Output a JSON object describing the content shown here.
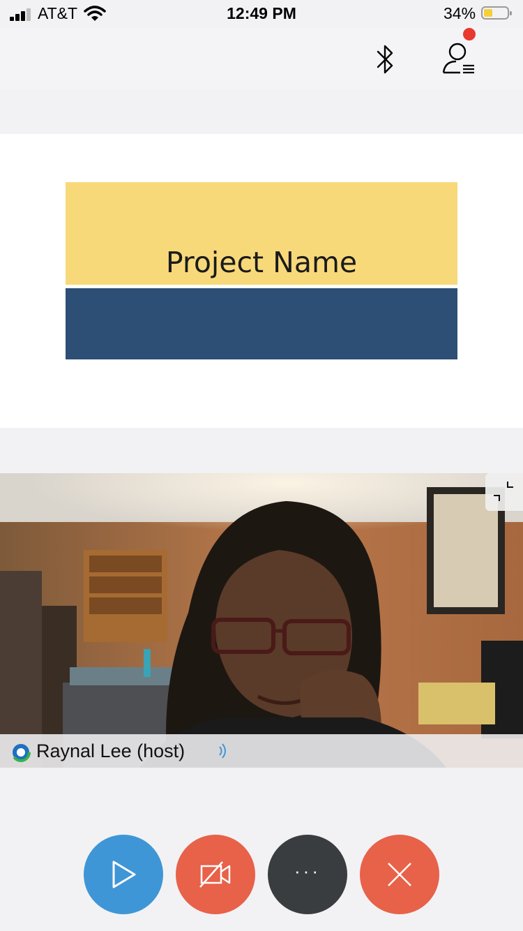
{
  "status_bar": {
    "carrier": "AT&T",
    "time": "12:49 PM",
    "battery_percent": "34%",
    "battery_level": 0.34
  },
  "toolbar": {
    "bluetooth_icon": "bluetooth-icon",
    "participants_icon": "participants-list-icon",
    "has_notification": true
  },
  "shared_content": {
    "slide_title": "Project Name",
    "colors": {
      "top_band": "#f8d97a",
      "bottom_band": "#2d4f75"
    }
  },
  "video": {
    "participant_name": "Raynal Lee (host)",
    "icons": [
      "exit-fullscreen-icon",
      "webex-logo-icon",
      "audio-speaking-icon"
    ]
  },
  "controls": [
    {
      "name": "share-button",
      "icon": "play-icon",
      "color": "#3f96d6"
    },
    {
      "name": "video-button",
      "icon": "video-off-icon",
      "color": "#e86149"
    },
    {
      "name": "more-button",
      "icon": "more-icon",
      "label": "···",
      "color": "#3a3d40"
    },
    {
      "name": "leave-button",
      "icon": "close-icon",
      "color": "#e86149"
    }
  ]
}
